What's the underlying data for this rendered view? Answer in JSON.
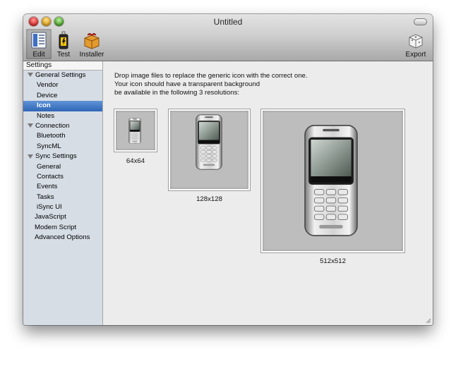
{
  "window": {
    "title": "Untitled"
  },
  "toolbar": {
    "items": [
      {
        "label": "Edit",
        "icon": "edit-icon",
        "selected": true
      },
      {
        "label": "Test",
        "icon": "test-icon",
        "selected": false
      },
      {
        "label": "Installer",
        "icon": "installer-icon",
        "selected": false
      }
    ],
    "export_label": "Export",
    "export_icon": "export-icon"
  },
  "sidebar": {
    "header": "Settings",
    "items": [
      {
        "label": "General Settings",
        "group": true
      },
      {
        "label": "Vendor"
      },
      {
        "label": "Device"
      },
      {
        "label": "Icon",
        "selected": true
      },
      {
        "label": "Notes"
      },
      {
        "label": "Connection",
        "group": true
      },
      {
        "label": "Bluetooth"
      },
      {
        "label": "SyncML"
      },
      {
        "label": "Sync Settings",
        "group": true
      },
      {
        "label": "General"
      },
      {
        "label": "Contacts"
      },
      {
        "label": "Events"
      },
      {
        "label": "Tasks"
      },
      {
        "label": "iSync UI"
      },
      {
        "label": "JavaScript"
      },
      {
        "label": "Modem Script"
      },
      {
        "label": "Advanced Options"
      }
    ]
  },
  "main": {
    "instructions": [
      "Drop image files to replace the generic icon with the correct one.",
      "Your icon should have a transparent background",
      "be available in the following 3 resolutions:"
    ],
    "wells": [
      {
        "label": "64x64"
      },
      {
        "label": "128x128"
      },
      {
        "label": "512x512"
      }
    ]
  },
  "colors": {
    "selection": "#3a72c2",
    "sidebar_bg": "#d6dde5",
    "window_bg": "#ececec"
  }
}
